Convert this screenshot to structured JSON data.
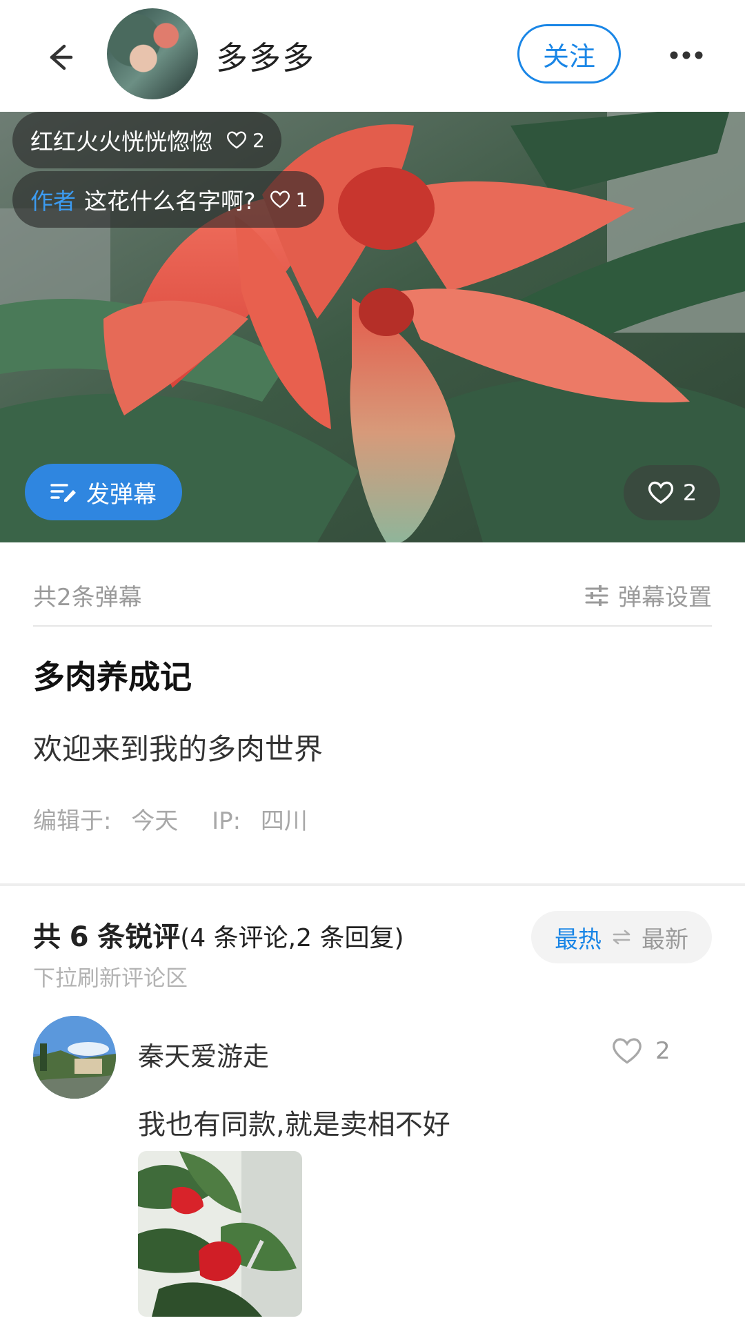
{
  "header": {
    "author_name": "多多多",
    "follow_label": "关注"
  },
  "photo": {
    "danmaku": [
      {
        "tag": "",
        "text": "红红火火恍恍惚惚",
        "likes": "2"
      },
      {
        "tag": "作者",
        "text": "这花什么名字啊?",
        "likes": "1"
      }
    ],
    "send_danmaku_label": "发弹幕",
    "like_count": "2"
  },
  "danmaku_bar": {
    "count_label": "共2条弹幕",
    "settings_label": "弹幕设置"
  },
  "post": {
    "title": "多肉养成记",
    "body": "欢迎来到我的多肉世界",
    "edited_label": "编辑于:",
    "edited_value": "今天",
    "ip_label": "IP:",
    "ip_value": "四川"
  },
  "comments_header": {
    "prefix": "共",
    "total": "6",
    "suffix": "条锐评",
    "detail": "(4 条评论,2 条回复)",
    "hint": "下拉刷新评论区",
    "sort_hot": "最热",
    "sort_new": "最新"
  },
  "comments": [
    {
      "user": "秦天爱游走",
      "likes": "2",
      "text": "我也有同款,就是卖相不好"
    }
  ],
  "colors": {
    "accent": "#1a86e6",
    "danmaku_button": "#2f86e0",
    "muted_text": "#9a9a9a"
  },
  "icons": [
    "back-arrow-icon",
    "more-dots-icon",
    "heart-icon",
    "danmaku-edit-icon",
    "sliders-icon",
    "swap-arrows-icon"
  ]
}
